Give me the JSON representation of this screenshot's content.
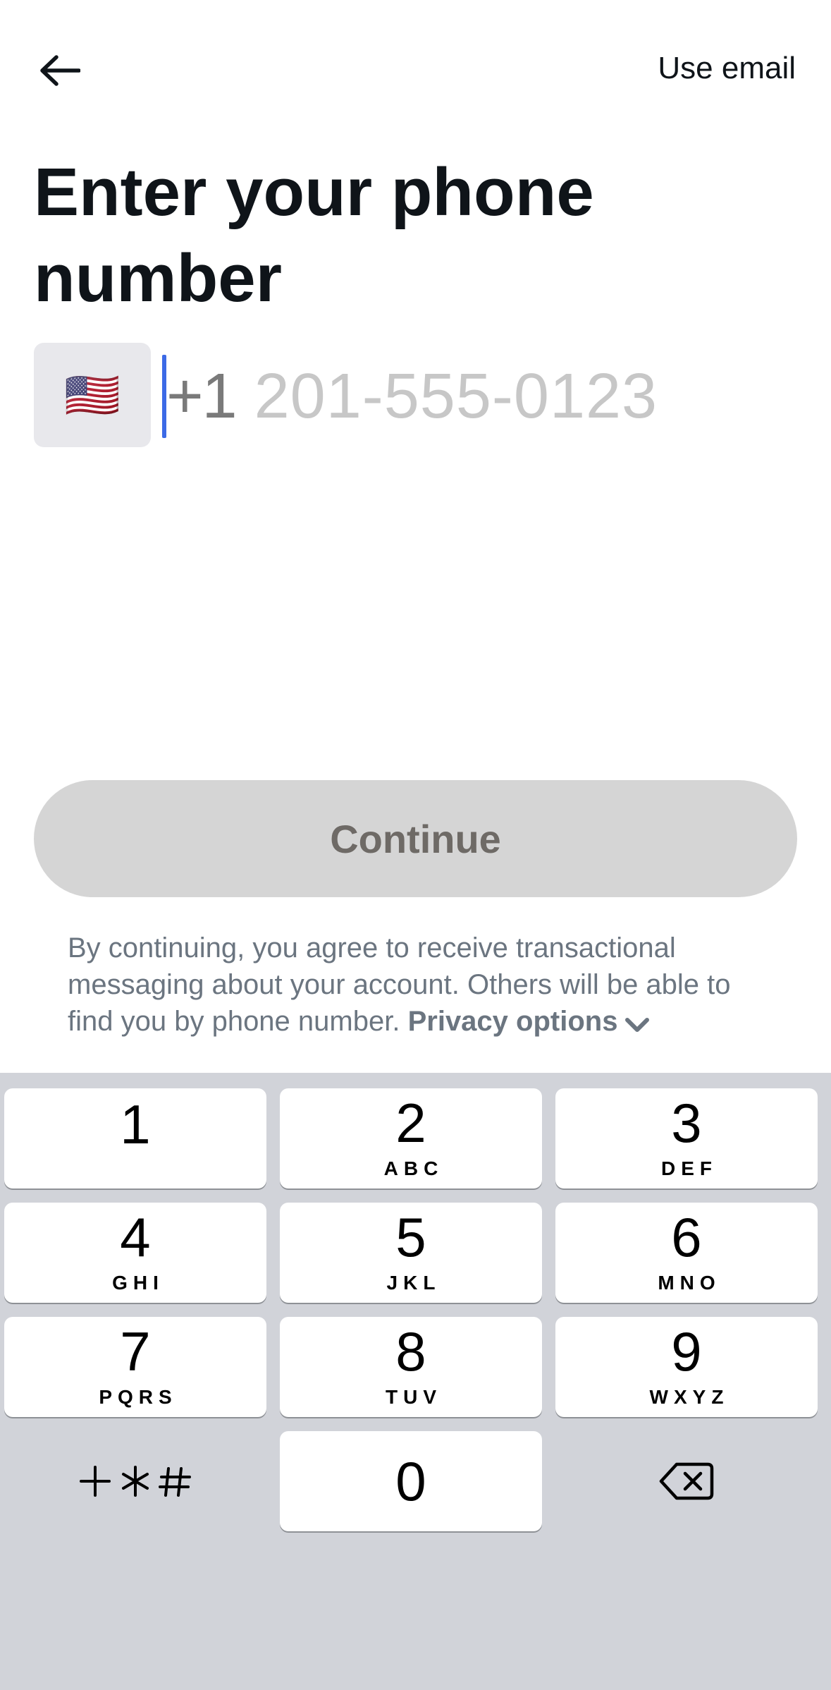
{
  "header": {
    "back_icon": "arrow-left-icon",
    "use_email_label": "Use email"
  },
  "main": {
    "title": "Enter your phone number",
    "country_flag": "🇺🇸",
    "dial_code": "+1",
    "phone_placeholder": "201-555-0123",
    "continue_label": "Continue",
    "disclaimer_text": "By continuing, you agree to receive transactional messaging about your account. Others will be able to find you by phone number.",
    "privacy_label": "Privacy options",
    "privacy_icon": "chevron-down-icon"
  },
  "keypad": {
    "keys": [
      {
        "digit": "1",
        "letters": ""
      },
      {
        "digit": "2",
        "letters": "ABC"
      },
      {
        "digit": "3",
        "letters": "DEF"
      },
      {
        "digit": "4",
        "letters": "GHI"
      },
      {
        "digit": "5",
        "letters": "JKL"
      },
      {
        "digit": "6",
        "letters": "MNO"
      },
      {
        "digit": "7",
        "letters": "PQRS"
      },
      {
        "digit": "8",
        "letters": "TUV"
      },
      {
        "digit": "9",
        "letters": "WXYZ"
      },
      {
        "digit": "0",
        "letters": ""
      }
    ],
    "symbols_label": "+*#",
    "delete_icon": "backspace-icon"
  },
  "colors": {
    "caret": "#3c6ae6",
    "keypad_bg": "#d1d3d9",
    "continue_disabled_bg": "#d5d5d5"
  }
}
